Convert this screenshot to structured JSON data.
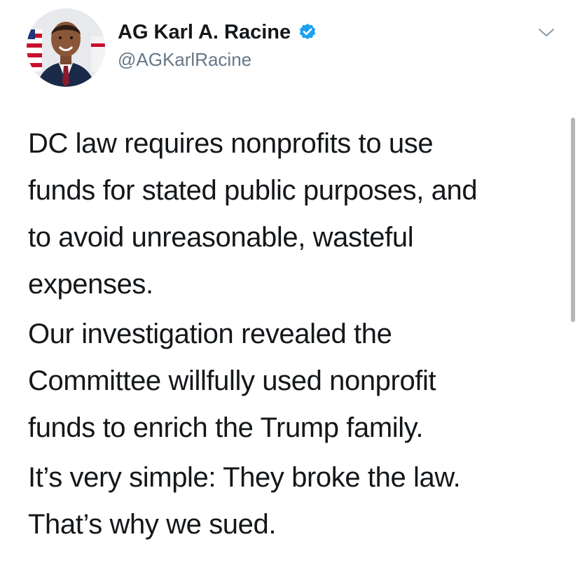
{
  "tweet": {
    "author": {
      "display_name": "AG Karl A. Racine",
      "handle": "@AGKarlRacine",
      "verified": true,
      "avatar_icon": "profile-photo"
    },
    "menu_icon": "chevron-down-icon",
    "paragraphs": [
      "DC law requires nonprofits to use\nfunds for stated public purposes, and\nto avoid unreasonable, wasteful\nexpenses.",
      "Our investigation revealed the\nCommittee willfully used nonprofit\nfunds to enrich the Trump family.",
      "It’s very simple: They broke the law.\nThat’s why we sued."
    ]
  },
  "colors": {
    "verified_badge": "#1da1f2",
    "handle": "#657786",
    "text": "#14171a"
  }
}
